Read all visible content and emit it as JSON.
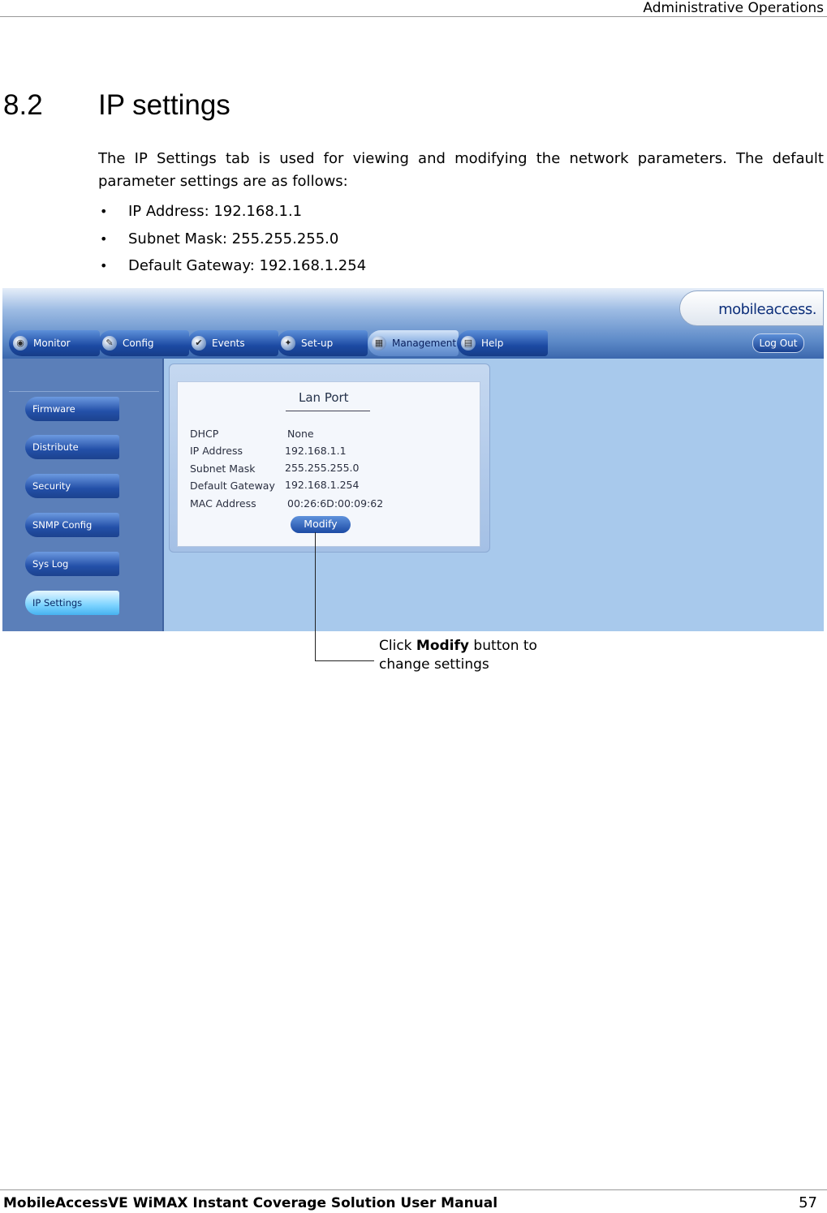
{
  "header": {
    "title": "Administrative Operations"
  },
  "section": {
    "number": "8.2",
    "title": "IP settings"
  },
  "intro": {
    "line1": "The IP Settings tab is used for viewing and modifying the network parameters. The default",
    "line2": "parameter settings are as follows:"
  },
  "bullets": [
    "IP Address: 192.168.1.1",
    "Subnet Mask: 255.255.255.0",
    "Default Gateway: 192.168.1.254"
  ],
  "app": {
    "logo": "mobileaccess.",
    "tabs": [
      {
        "label": "Monitor",
        "icon": "monitor-icon"
      },
      {
        "label": "Config",
        "icon": "wrench-icon"
      },
      {
        "label": "Events",
        "icon": "events-icon"
      },
      {
        "label": "Set-up",
        "icon": "wand-icon"
      },
      {
        "label": "Management",
        "icon": "management-icon"
      },
      {
        "label": "Help",
        "icon": "book-icon"
      }
    ],
    "active_tab": "Management",
    "logout": "Log Out",
    "sidebar": [
      "Firmware",
      "Distribute",
      "Security",
      "SNMP Config",
      "Sys Log",
      "IP Settings"
    ],
    "active_sidebar": "IP Settings",
    "panel": {
      "title": "Lan Port",
      "fields": [
        {
          "label": "DHCP",
          "value": "None"
        },
        {
          "label": "IP Address",
          "value": "192.168.1.1"
        },
        {
          "label": "Subnet Mask",
          "value": "255.255.255.0"
        },
        {
          "label": "Default Gateway",
          "value": "192.168.1.254"
        },
        {
          "label": "MAC Address",
          "value": "00:26:6D:00:09:62"
        }
      ],
      "modify": "Modify"
    }
  },
  "callout": {
    "prefix": "Click ",
    "bold": "Modify",
    "suffix": " button to",
    "line2": "change settings"
  },
  "footer": {
    "title": "MobileAccessVE WiMAX Instant Coverage Solution User Manual",
    "page": "57"
  }
}
